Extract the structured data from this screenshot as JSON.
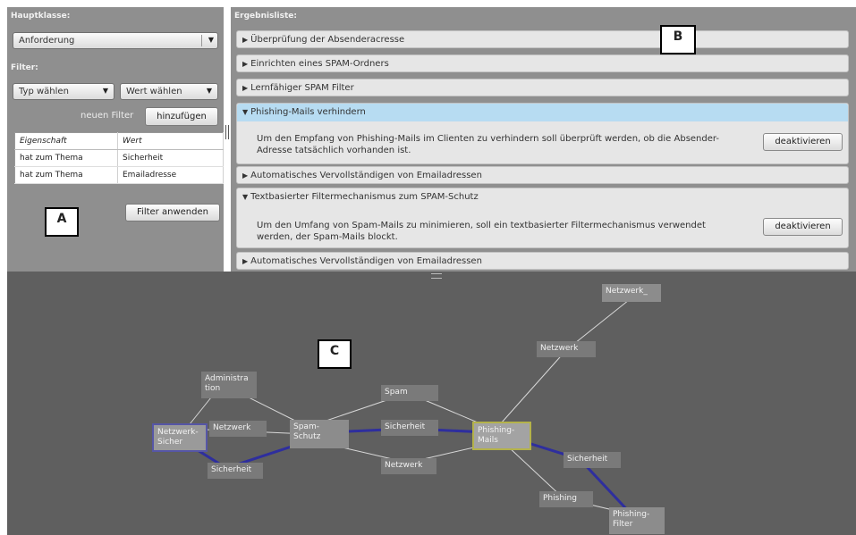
{
  "panel_a": {
    "hauptklasse_label": "Hauptklasse:",
    "hauptklasse_value": "Anforderung",
    "filter_label": "Filter:",
    "typ_select": "Typ wählen",
    "wert_select": "Wert wählen",
    "neuer_filter_label": "neuen Filter",
    "hinzufuegen_button": "hinzufügen",
    "table": {
      "headers": [
        "Eigenschaft",
        "Wert"
      ],
      "rows": [
        [
          "hat zum Thema",
          "Sicherheit"
        ],
        [
          "hat zum Thema",
          "Emailadresse"
        ]
      ]
    },
    "filter_anwenden_button": "Filter anwenden",
    "annotation": "A"
  },
  "panel_b": {
    "header": "Ergebnisliste:",
    "annotation": "B",
    "items": [
      {
        "title": "Überprüfung der Absenderacresse",
        "expanded": false
      },
      {
        "title": "Einrichten eines SPAM-Ordners",
        "expanded": false
      },
      {
        "title": "Lernfähiger SPAM Filter",
        "expanded": false
      },
      {
        "title": "Phishing-Mails verhindern",
        "expanded": true,
        "highlight": true,
        "desc": "Um den Empfang von Phishing-Mails im Clienten zu verhindern soll überprüft werden, ob die Absender-Adresse tatsächlich vorhanden ist.",
        "button": "deaktivieren"
      },
      {
        "title": "Automatisches Vervollständigen von Emailadressen",
        "expanded": false
      },
      {
        "title": "Textbasierter Filtermechanismus zum SPAM-Schutz",
        "expanded": true,
        "desc": "Um den Umfang von Spam-Mails zu minimieren, soll ein textbasierter Filtermechanismus verwendet werden, der Spam-Mails blockt.",
        "button": "deaktivieren"
      },
      {
        "title": "Automatisches Vervollständigen von Emailadressen",
        "expanded": false
      }
    ],
    "triangle_collapsed": "▶",
    "triangle_expanded": "▼"
  },
  "panel_c": {
    "annotation": "C",
    "nodes": {
      "netzwerk_sicher": "Netzwerk-Sicher",
      "spam_schutz": "Spam-Schutz",
      "phishing_mails": "Phishing-Mails",
      "netzwerk_top": "Netzwerk_",
      "phishing_filter": "Phishing-Filter"
    },
    "edge_labels": {
      "administration": "Administra tion",
      "netzwerk_left": "Netzwerk",
      "sicherheit_left": "Sicherheit",
      "spam": "Spam",
      "sicherheit_mid": "Sicherheit",
      "netzwerk_mid": "Netzwerk",
      "netzwerk_right": "Netzwerk",
      "sicherheit_right": "Sicherheit",
      "phishing": "Phishing"
    },
    "colors": {
      "strong_edge": "#2e2e9e",
      "light_edge": "#d8d8d8",
      "highlight": "#b4b24a"
    }
  }
}
